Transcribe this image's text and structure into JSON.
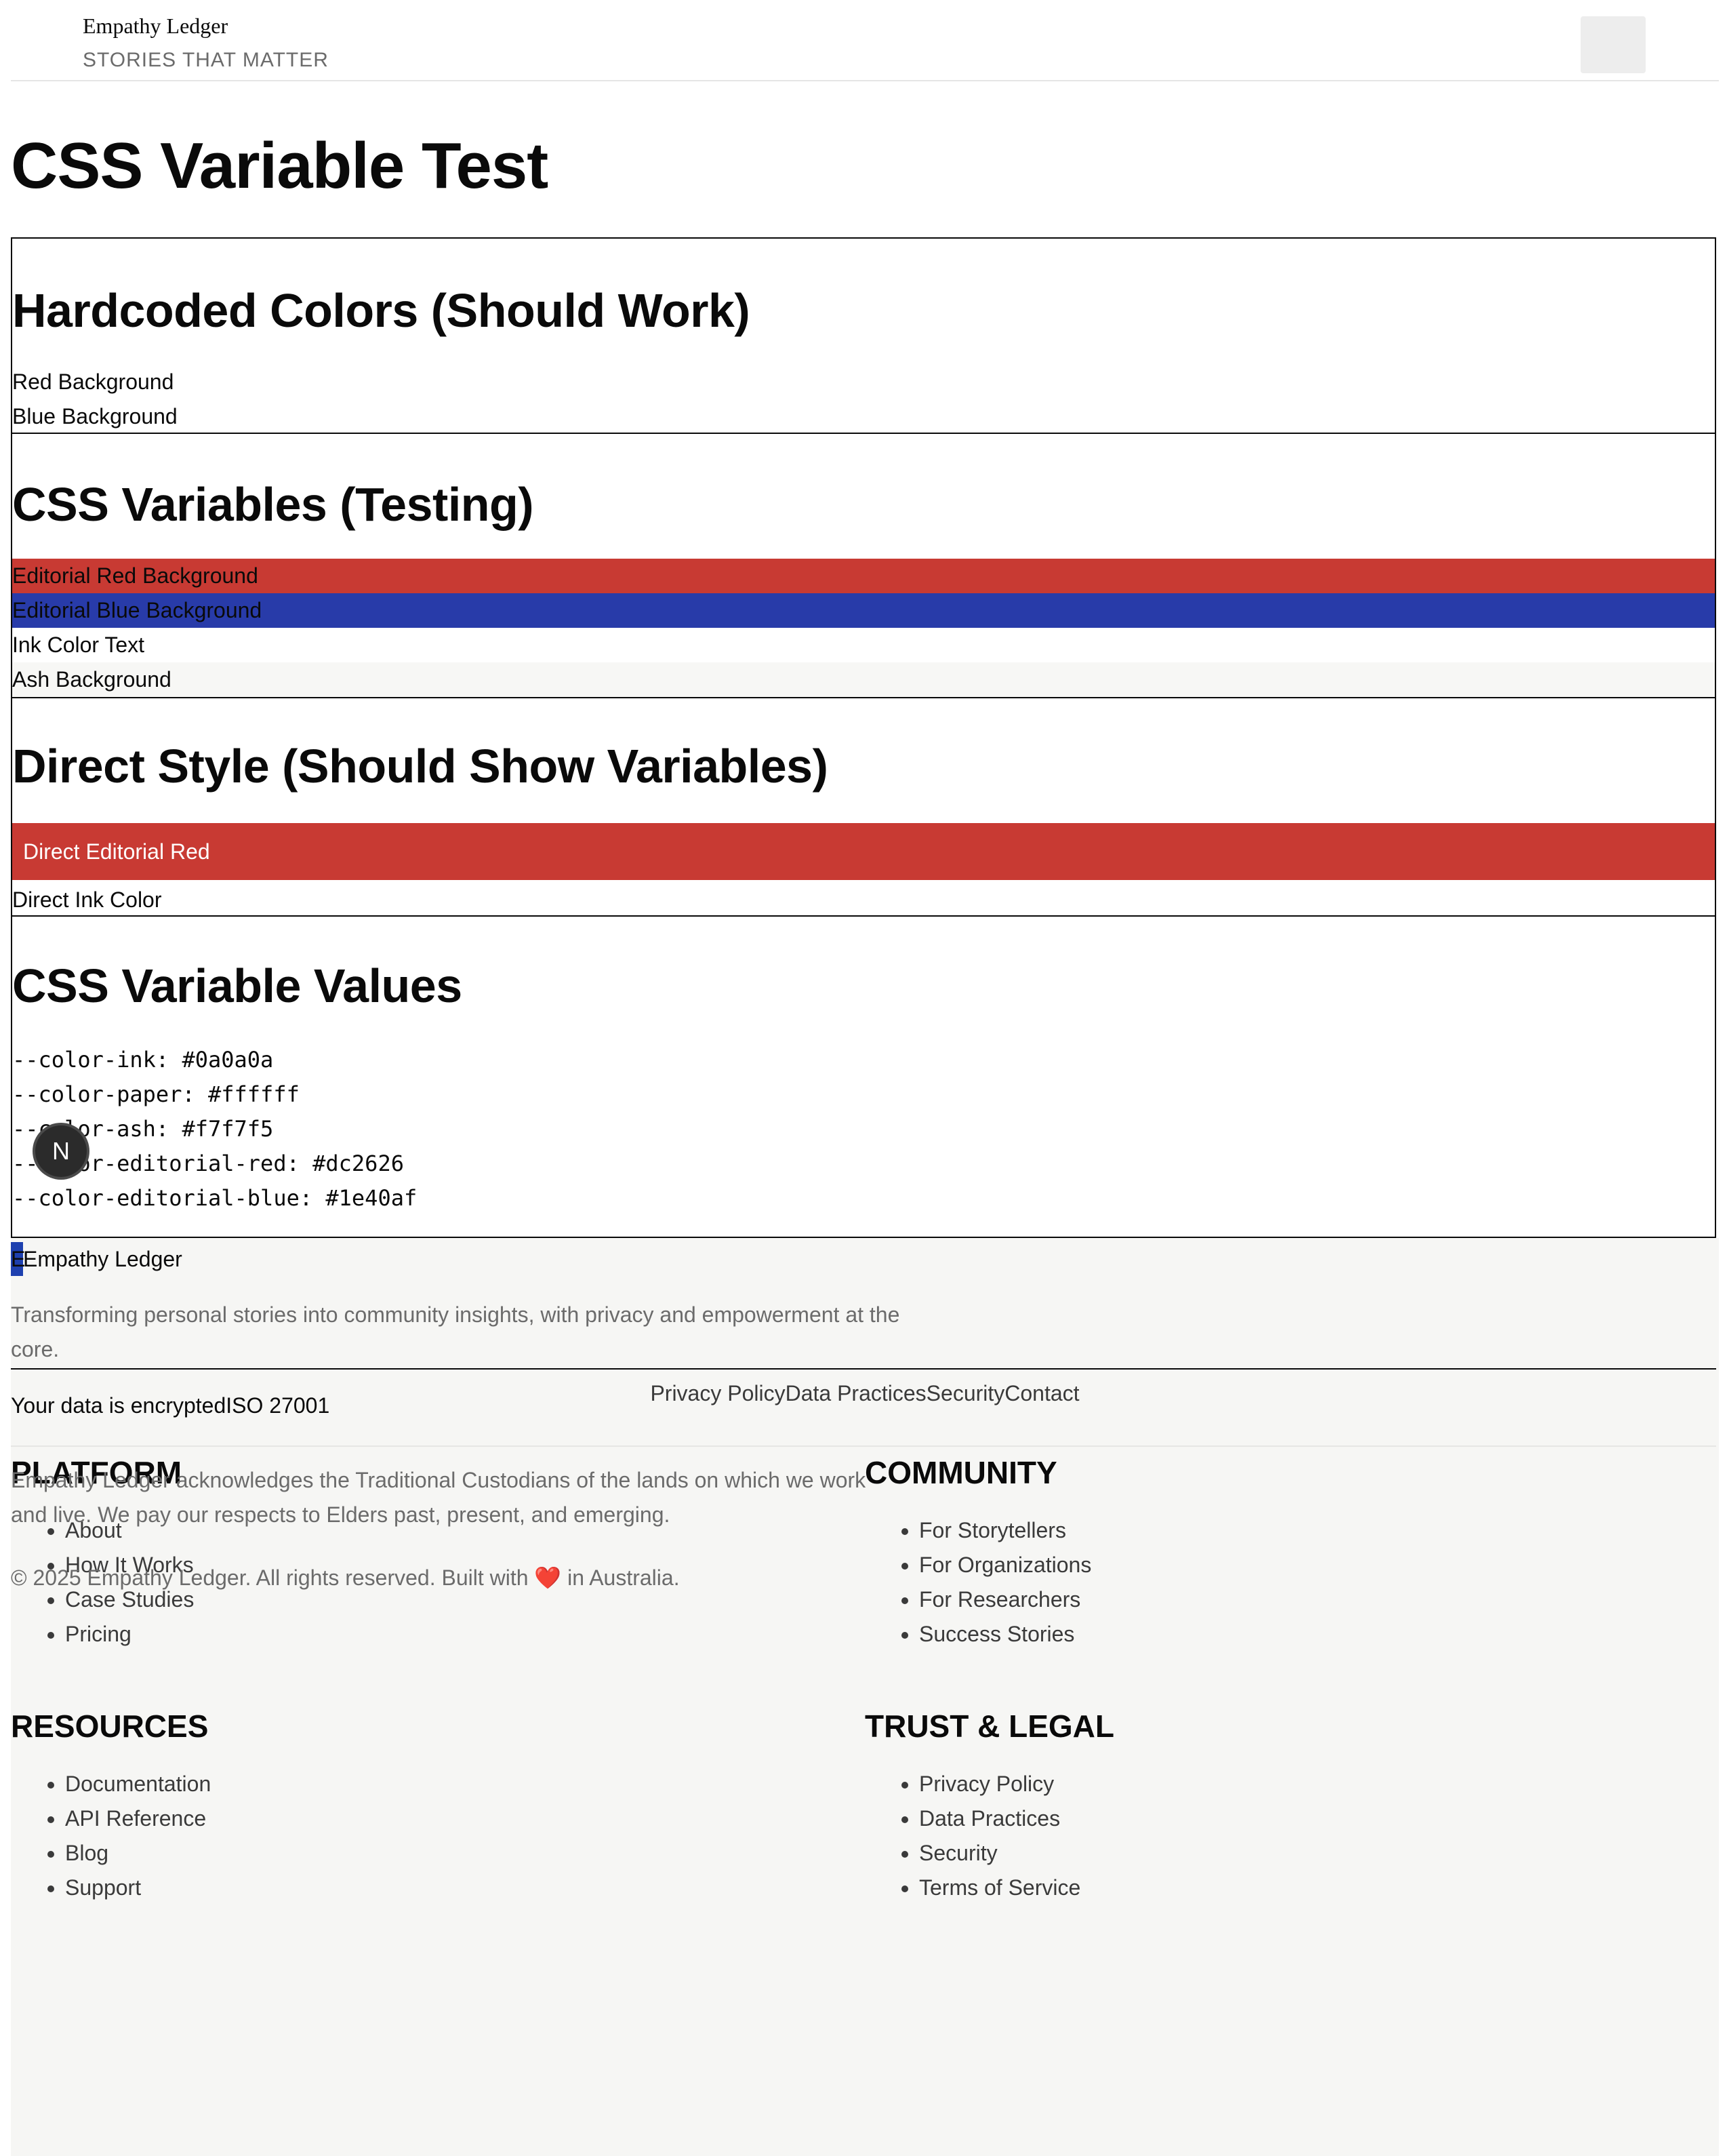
{
  "header": {
    "brand": "Empathy Ledger",
    "tagline": "STORIES THAT MATTER"
  },
  "page_title": "CSS Variable Test",
  "sections": {
    "hardcoded": {
      "title": "Hardcoded Colors (Should Work)",
      "rows": [
        "Red Background",
        "Blue Background"
      ]
    },
    "variables": {
      "title": "CSS Variables (Testing)",
      "rows": [
        "Editorial Red Background",
        "Editorial Blue Background",
        "Ink Color Text",
        "Ash Background"
      ]
    },
    "direct": {
      "title": "Direct Style (Should Show Variables)",
      "red_label": "Direct Editorial Red",
      "ink_label": "Direct Ink Color"
    },
    "values": {
      "title": "CSS Variable Values",
      "lines": [
        "--color-ink: #0a0a0a",
        "--color-paper: #ffffff",
        "--color-ash: #f7f7f5",
        "--color-editorial-red: #dc2626",
        "--color-editorial-blue: #1e40af"
      ]
    }
  },
  "colors": {
    "editorial_red_rendered": "#c83a33",
    "editorial_blue_rendered": "#283ba9",
    "ash": "#f7f7f5"
  },
  "dev_badge": "N",
  "footer": {
    "brand_mark": "E",
    "brand": "Empathy Ledger",
    "description": "Transforming personal stories into community insights, with privacy and empowerment at the core.",
    "badges": "Your data is encryptedISO 27001",
    "columns": [
      {
        "title": "PLATFORM",
        "items": [
          "About",
          "How It Works",
          "Case Studies",
          "Pricing"
        ]
      },
      {
        "title": "COMMUNITY",
        "items": [
          "For Storytellers",
          "For Organizations",
          "For Researchers",
          "Success Stories"
        ]
      },
      {
        "title": "RESOURCES",
        "items": [
          "Documentation",
          "API Reference",
          "Blog",
          "Support"
        ]
      },
      {
        "title": "TRUST & LEGAL",
        "items": [
          "Privacy Policy",
          "Data Practices",
          "Security",
          "Terms of Service"
        ]
      }
    ],
    "bottom_links": [
      "Privacy Policy",
      "Data Practices",
      "Security",
      "Contact"
    ],
    "acknowledgement": "Empathy Ledger acknowledges the Traditional Custodians of the lands on which we work and live. We pay our respects to Elders past, present, and emerging.",
    "copyright_before": "© 2025 Empathy Ledger. All rights reserved. Built with",
    "heart": "❤️",
    "copyright_after": "in Australia."
  }
}
